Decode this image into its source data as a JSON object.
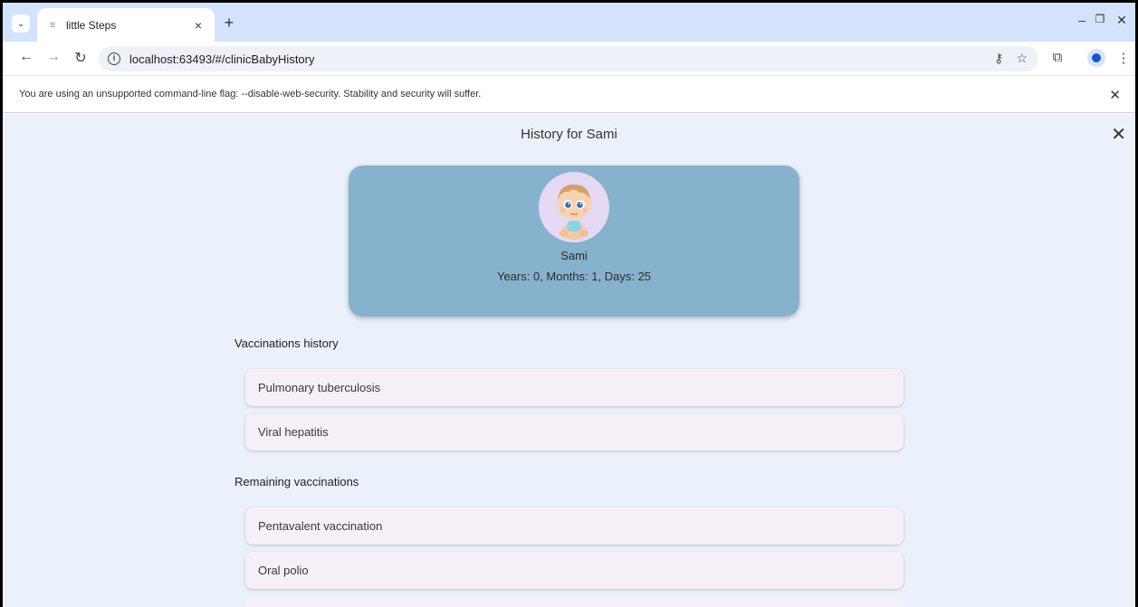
{
  "browser": {
    "tab_title": "little Steps",
    "tab_close": "×",
    "new_tab": "+",
    "url": "localhost:63493/#/clinicBabyHistory",
    "infobar_text": "You are using an unsupported command-line flag: --disable-web-security. Stability and security will suffer.",
    "win_min": "–",
    "win_restore": "❐",
    "win_close": "✕"
  },
  "app": {
    "title": "History for Sami",
    "baby": {
      "name": "Sami",
      "age": "Years: 0, Months: 1, Days: 25"
    },
    "vaccinations_history": {
      "heading": "Vaccinations history",
      "items": [
        "Pulmonary tuberculosis",
        "Viral hepatitis"
      ]
    },
    "remaining_vaccinations": {
      "heading": "Remaining vaccinations",
      "items": [
        "Pentavalent vaccination",
        "Oral polio"
      ]
    }
  },
  "colors": {
    "tabstrip": "#d3e3fd",
    "app_background": "#eaf1fa",
    "profile_card": "#87b2cd",
    "list_item": "#f6eff8"
  }
}
